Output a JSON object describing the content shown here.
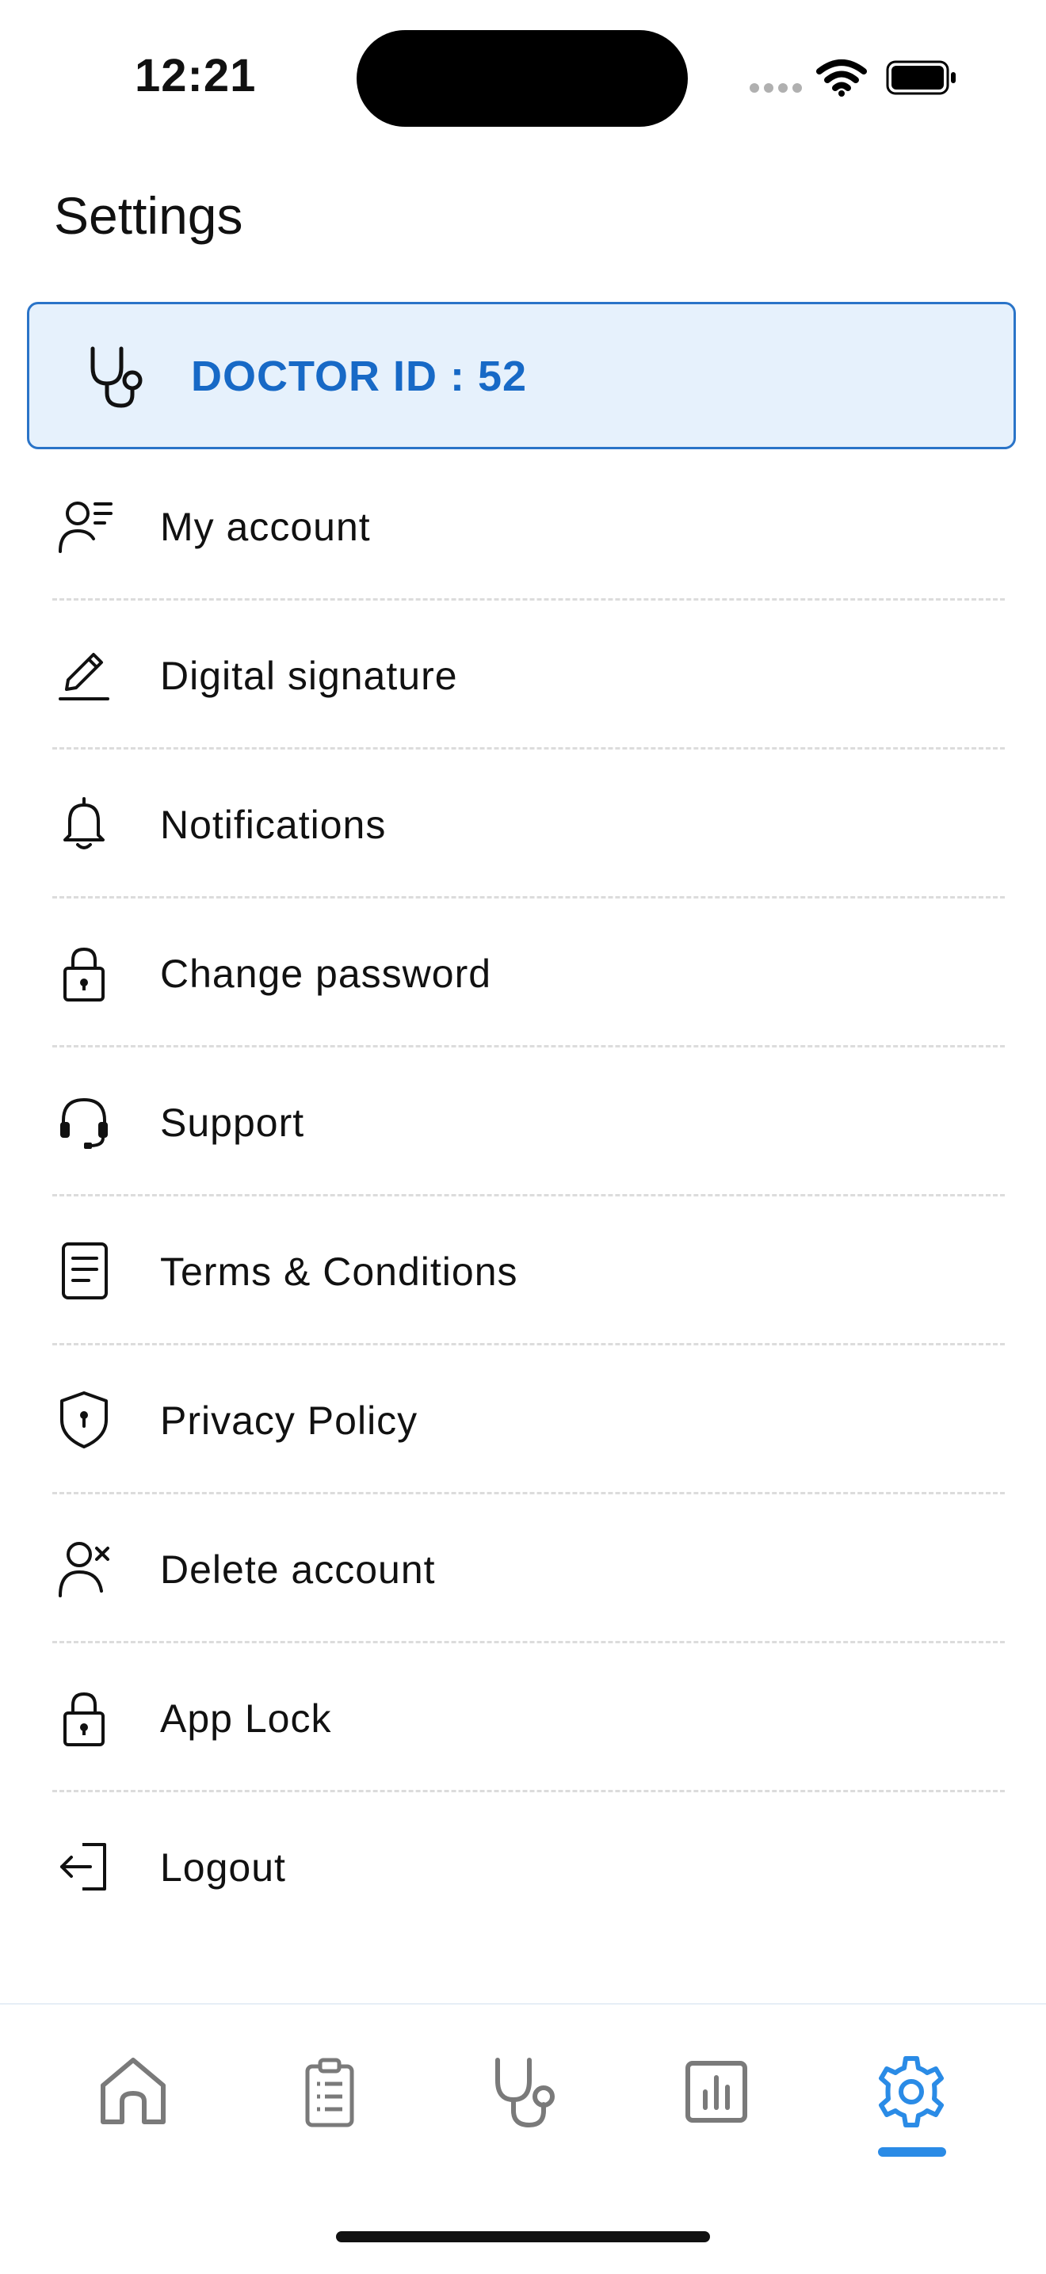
{
  "status_bar": {
    "time": "12:21"
  },
  "page": {
    "title": "Settings"
  },
  "doctor_card": {
    "label": "DOCTOR ID : 52"
  },
  "menu": [
    {
      "label": "My account",
      "icon": "user-list-icon"
    },
    {
      "label": "Digital signature",
      "icon": "pen-icon"
    },
    {
      "label": "Notifications",
      "icon": "bell-icon"
    },
    {
      "label": "Change password",
      "icon": "lock-icon"
    },
    {
      "label": "Support",
      "icon": "headset-icon"
    },
    {
      "label": "Terms & Conditions",
      "icon": "document-icon"
    },
    {
      "label": "Privacy Policy",
      "icon": "shield-icon"
    },
    {
      "label": "Delete account",
      "icon": "user-remove-icon"
    },
    {
      "label": "App Lock",
      "icon": "lock-icon"
    },
    {
      "label": "Logout",
      "icon": "logout-icon"
    }
  ],
  "bottom_nav": [
    {
      "icon": "home-icon",
      "active": false
    },
    {
      "icon": "clipboard-icon",
      "active": false
    },
    {
      "icon": "stethoscope-icon",
      "active": false
    },
    {
      "icon": "chart-icon",
      "active": false
    },
    {
      "icon": "gear-icon",
      "active": true
    }
  ],
  "colors": {
    "accent": "#1769c6",
    "card_bg": "#e6f1fc",
    "nav_active": "#2a8be6",
    "nav_inactive": "#7a7a7a"
  }
}
